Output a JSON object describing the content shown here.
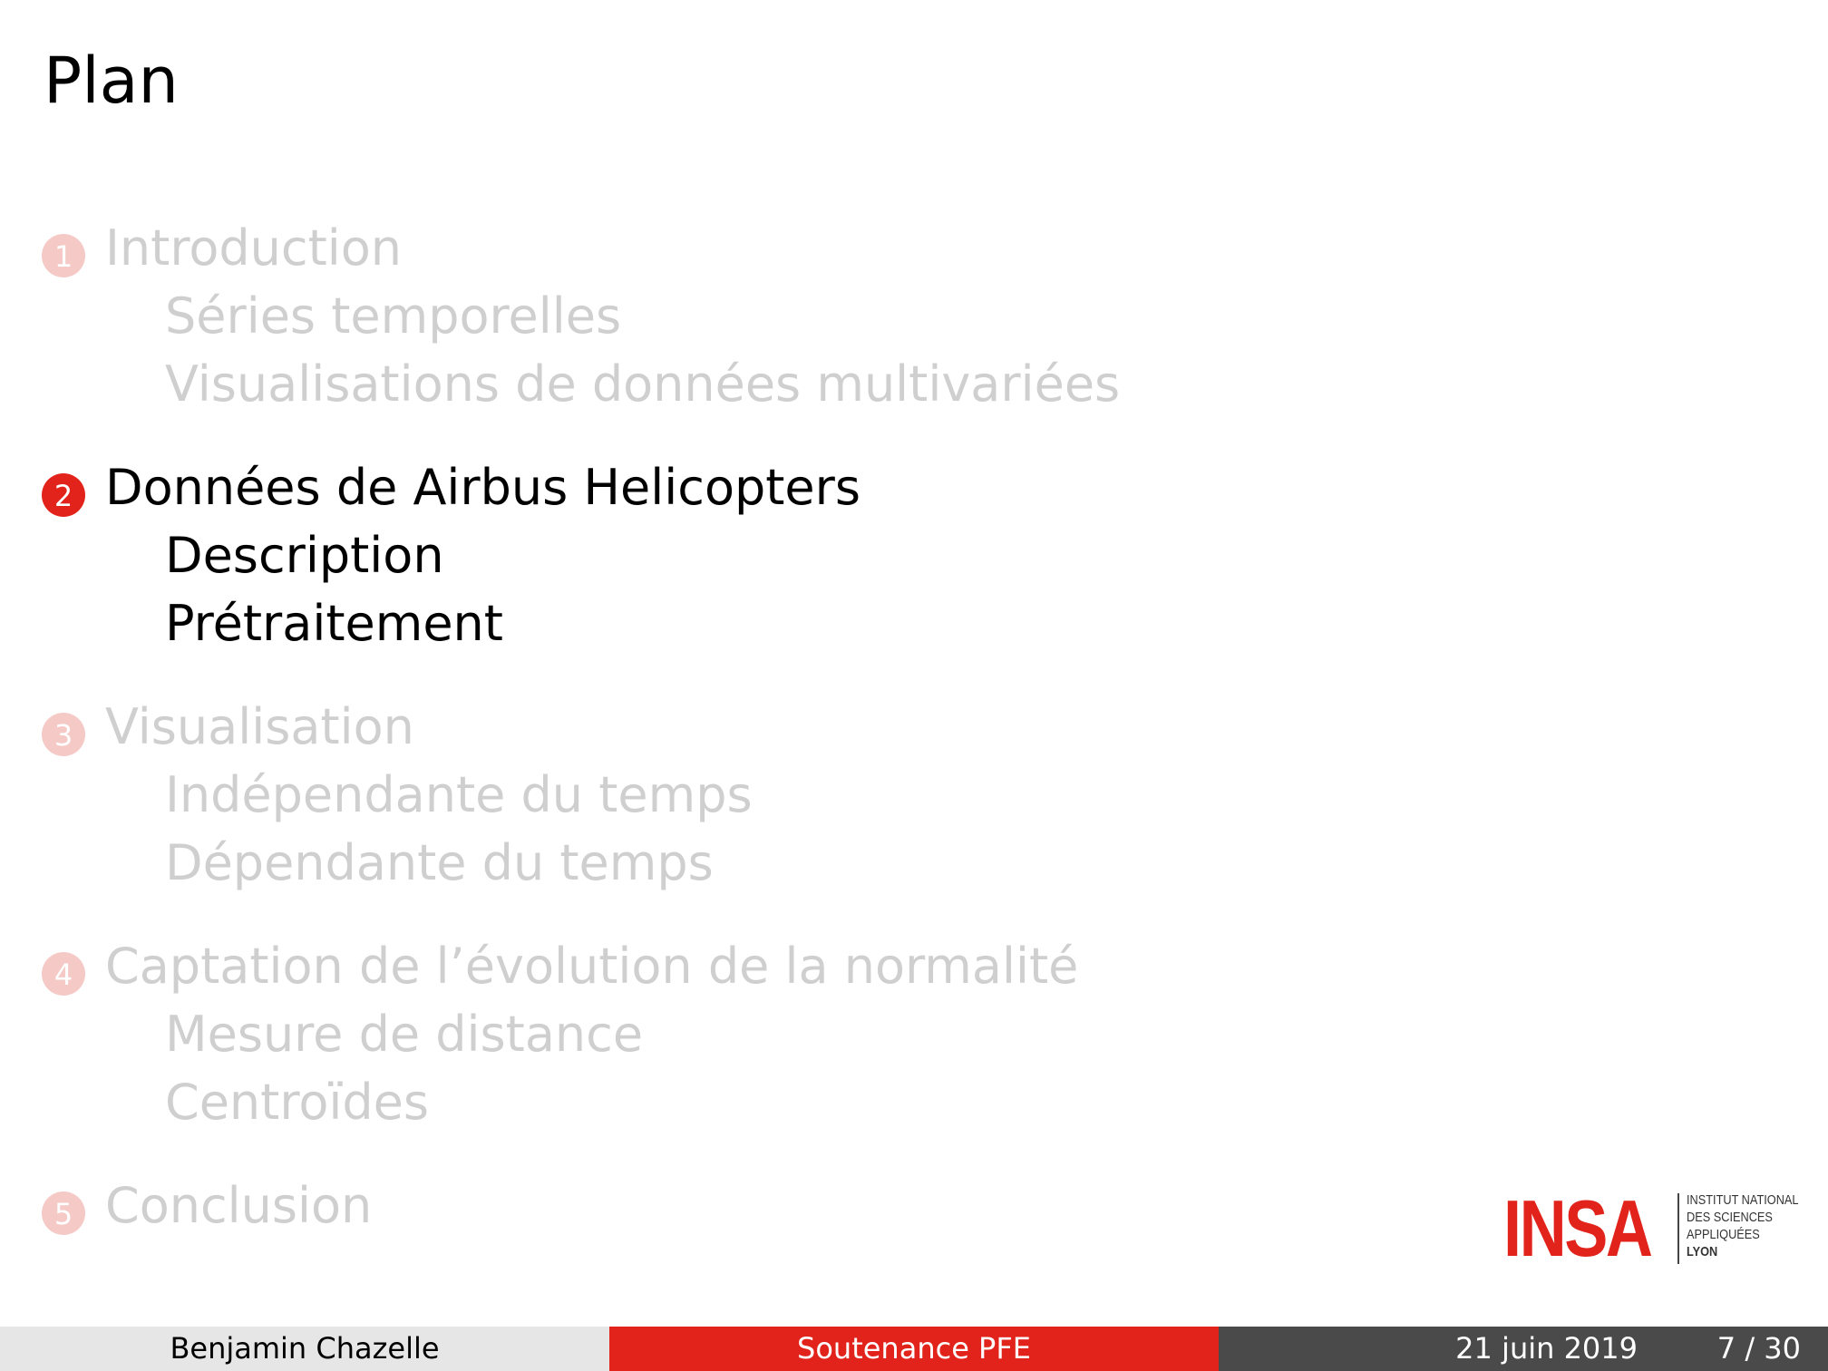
{
  "slide": {
    "title": "Plan"
  },
  "toc": {
    "sections": [
      {
        "number": "1",
        "label": "Introduction",
        "state": "dim",
        "subsections": [
          "Séries temporelles",
          "Visualisations de données multivariées"
        ]
      },
      {
        "number": "2",
        "label": "Données de Airbus Helicopters",
        "state": "active",
        "subsections": [
          "Description",
          "Prétraitement"
        ]
      },
      {
        "number": "3",
        "label": "Visualisation",
        "state": "dim",
        "subsections": [
          "Indépendante du temps",
          "Dépendante du temps"
        ]
      },
      {
        "number": "4",
        "label": "Captation de l’évolution de la normalité",
        "state": "dim",
        "subsections": [
          "Mesure de distance",
          "Centroïdes"
        ]
      },
      {
        "number": "5",
        "label": "Conclusion",
        "state": "dim",
        "subsections": []
      }
    ]
  },
  "logo": {
    "word": "INSA",
    "lines": [
      "INSTITUT NATIONAL",
      "DES SCIENCES",
      "APPLIQUÉES",
      "LYON"
    ]
  },
  "footer": {
    "author": "Benjamin Chazelle",
    "event": "Soutenance PFE",
    "date": "21 juin 2019",
    "page": "7 / 30"
  },
  "colors": {
    "accent": "#e1231b",
    "dim_text": "#cfcfcf",
    "dim_number": "#f5c9c6",
    "footer_left": "#e6e6e6",
    "footer_right": "#4a4a4a"
  }
}
